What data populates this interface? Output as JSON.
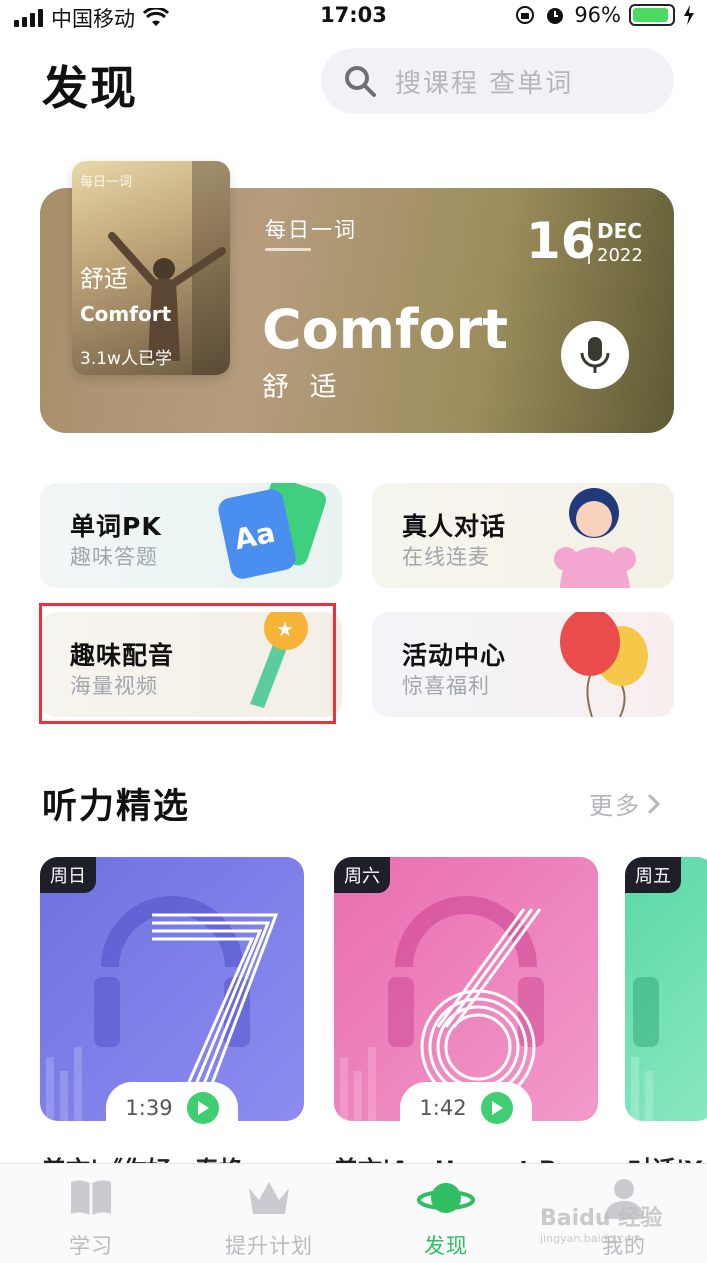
{
  "status_bar": {
    "carrier": "中国移动",
    "time": "17:03",
    "battery": "96%"
  },
  "header": {
    "title": "发现",
    "search_placeholder": "搜课程 查单词"
  },
  "word_of_day": {
    "thumb_tag": "每日一词",
    "thumb_cn": "舒适",
    "thumb_en": "Comfort",
    "thumb_count": "3.1w人已学",
    "label": "每日一词",
    "day": "16",
    "month": "DEC",
    "year": "2022",
    "word": "Comfort",
    "meaning": "舒 适"
  },
  "features": [
    {
      "title": "单词PK",
      "subtitle": "趣味答题"
    },
    {
      "title": "真人对话",
      "subtitle": "在线连麦"
    },
    {
      "title": "趣味配音",
      "subtitle": "海量视频"
    },
    {
      "title": "活动中心",
      "subtitle": "惊喜福利"
    }
  ],
  "section": {
    "title": "听力精选",
    "more": "更多"
  },
  "listening": [
    {
      "day": "周日",
      "duration": "1:39",
      "title": "美文|《你好，春格"
    },
    {
      "day": "周六",
      "duration": "1:42",
      "title": "美文|An Honest R"
    },
    {
      "day": "周五",
      "title": "对话|Y"
    }
  ],
  "tabs": [
    {
      "label": "学习"
    },
    {
      "label": "提升计划"
    },
    {
      "label": "发现"
    },
    {
      "label": "我的"
    }
  ],
  "watermark": {
    "brand": "Baidu 经验",
    "url": "jingyan.baidu.com"
  },
  "colors": {
    "accent": "#2fbf62",
    "highlight": "#e8333a"
  }
}
